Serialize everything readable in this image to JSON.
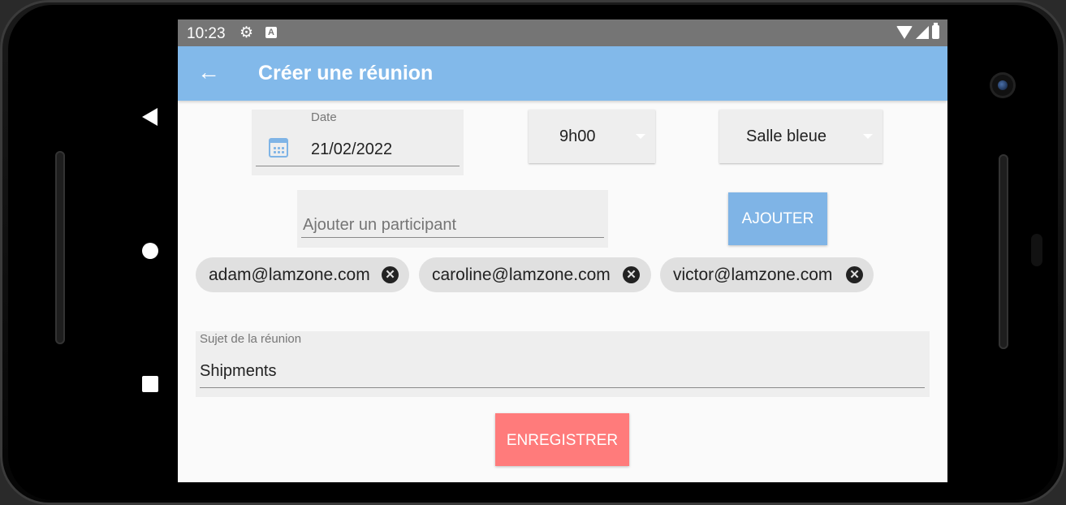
{
  "status_bar": {
    "time": "10:23",
    "icons": [
      "gear-icon",
      "a-notification-icon",
      "wifi-icon",
      "signal-icon",
      "battery-icon"
    ]
  },
  "app_bar": {
    "title": "Créer une réunion",
    "back_icon": "arrow-left-icon",
    "color": "#82b9ea"
  },
  "form": {
    "date": {
      "label": "Date",
      "value": "21/02/2022",
      "icon": "calendar-icon"
    },
    "time_select": {
      "value": "9h00"
    },
    "room_select": {
      "value": "Salle bleue"
    },
    "participant_input": {
      "placeholder": "Ajouter un participant",
      "value": ""
    },
    "add_button": {
      "label": "AJOUTER",
      "color": "#7fb4e6"
    },
    "participants": [
      {
        "email": "adam@lamzone.com"
      },
      {
        "email": "caroline@lamzone.com"
      },
      {
        "email": "victor@lamzone.com"
      }
    ],
    "subject": {
      "label": "Sujet de la réunion",
      "value": "Shipments"
    },
    "save_button": {
      "label": "ENREGISTRER",
      "color": "#ff7b7b"
    }
  }
}
